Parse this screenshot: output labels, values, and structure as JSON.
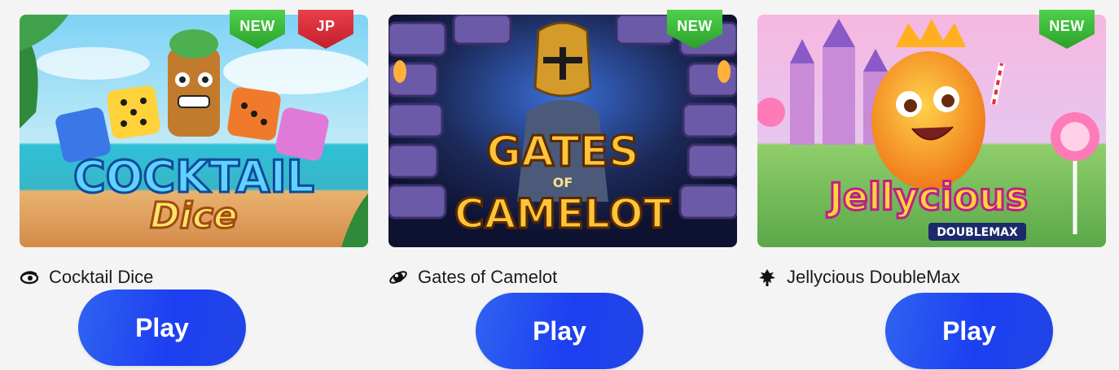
{
  "cards": [
    {
      "title": "Cocktail Dice",
      "cover_line1": "COCKTAIL",
      "cover_line2": "Dice",
      "badges": [
        "NEW",
        "JP"
      ],
      "provider_icon": "eye-icon",
      "play_label": "Play"
    },
    {
      "title": "Gates of Camelot",
      "cover_line1": "GATES",
      "cover_line2": "OF",
      "cover_line3": "CAMELOT",
      "badges": [
        "NEW"
      ],
      "provider_icon": "planet-icon",
      "play_label": "Play"
    },
    {
      "title": "Jellycious DoubleMax",
      "cover_line1": "Jellycious",
      "cover_line2": "DOUBLEMAX",
      "badges": [
        "NEW"
      ],
      "provider_icon": "tree-icon",
      "play_label": "Play"
    }
  ],
  "colors": {
    "page_background": "#f4f4f4",
    "play_button": "#1d3ff2",
    "new_badge": "#2aa12a",
    "jp_badge": "#c21f2a"
  }
}
